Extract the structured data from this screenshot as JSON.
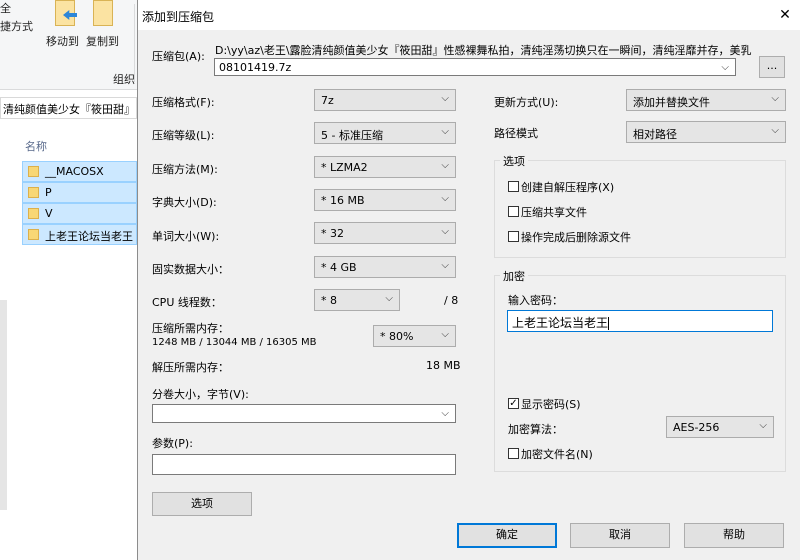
{
  "explorer": {
    "ribbon": {
      "fragment_top": "全",
      "fragment_mode": "捷方式",
      "move_to": "移动到",
      "copy_to": "复制到",
      "group_label": "组织"
    },
    "path_text": "清纯颜值美少女『筱田甜』",
    "column_name": "名称",
    "files": [
      "__MACOSX",
      "P",
      "V",
      "上老王论坛当老王"
    ]
  },
  "dialog": {
    "title": "添加到压缩包",
    "archive_label": "压缩包(A):",
    "archive_path": "D:\\yy\\az\\老王\\露脸清纯颜值美少女『筱田甜』性感裸舞私拍，清纯淫荡切换只在一瞬间，清纯淫靡并存，美乳",
    "archive_name": "08101419.7z",
    "browse_label": "...",
    "format_label": "压缩格式(F):",
    "format_value": "7z",
    "level_label": "压缩等级(L):",
    "level_value": "5 - 标准压缩",
    "method_label": "压缩方法(M):",
    "method_value": "* LZMA2",
    "dict_label": "字典大小(D):",
    "dict_value": "* 16 MB",
    "word_label": "单词大小(W):",
    "word_value": "* 32",
    "solid_label": "固实数据大小：",
    "solid_value": "* 4 GB",
    "threads_label": "CPU 线程数：",
    "threads_value": "* 8",
    "threads_max": "/ 8",
    "mem_comp_label": "压缩所需内存：",
    "mem_comp_detail": "1248 MB / 13044 MB / 16305 MB",
    "mem_comp_value": "* 80%",
    "mem_decomp_label": "解压所需内存：",
    "mem_decomp_value": "18 MB",
    "split_label": "分卷大小，字节(V):",
    "split_value": "",
    "params_label": "参数(P):",
    "params_value": "",
    "options_button": "选项",
    "update_label": "更新方式(U):",
    "update_value": "添加并替换文件",
    "pathmode_label": "路径模式",
    "pathmode_value": "相对路径",
    "options_group": {
      "title": "选项",
      "sfx": "创建自解压程序(X)",
      "shared": "压缩共享文件",
      "delete": "操作完成后删除源文件"
    },
    "encrypt_group": {
      "title": "加密",
      "password_label": "输入密码：",
      "password_value": "上老王论坛当老王",
      "show_password": "显示密码(S)",
      "show_password_checked": true,
      "method_label": "加密算法：",
      "method_value": "AES-256",
      "encrypt_names": "加密文件名(N)",
      "encrypt_names_checked": false
    },
    "ok": "确定",
    "cancel": "取消",
    "help": "帮助"
  }
}
